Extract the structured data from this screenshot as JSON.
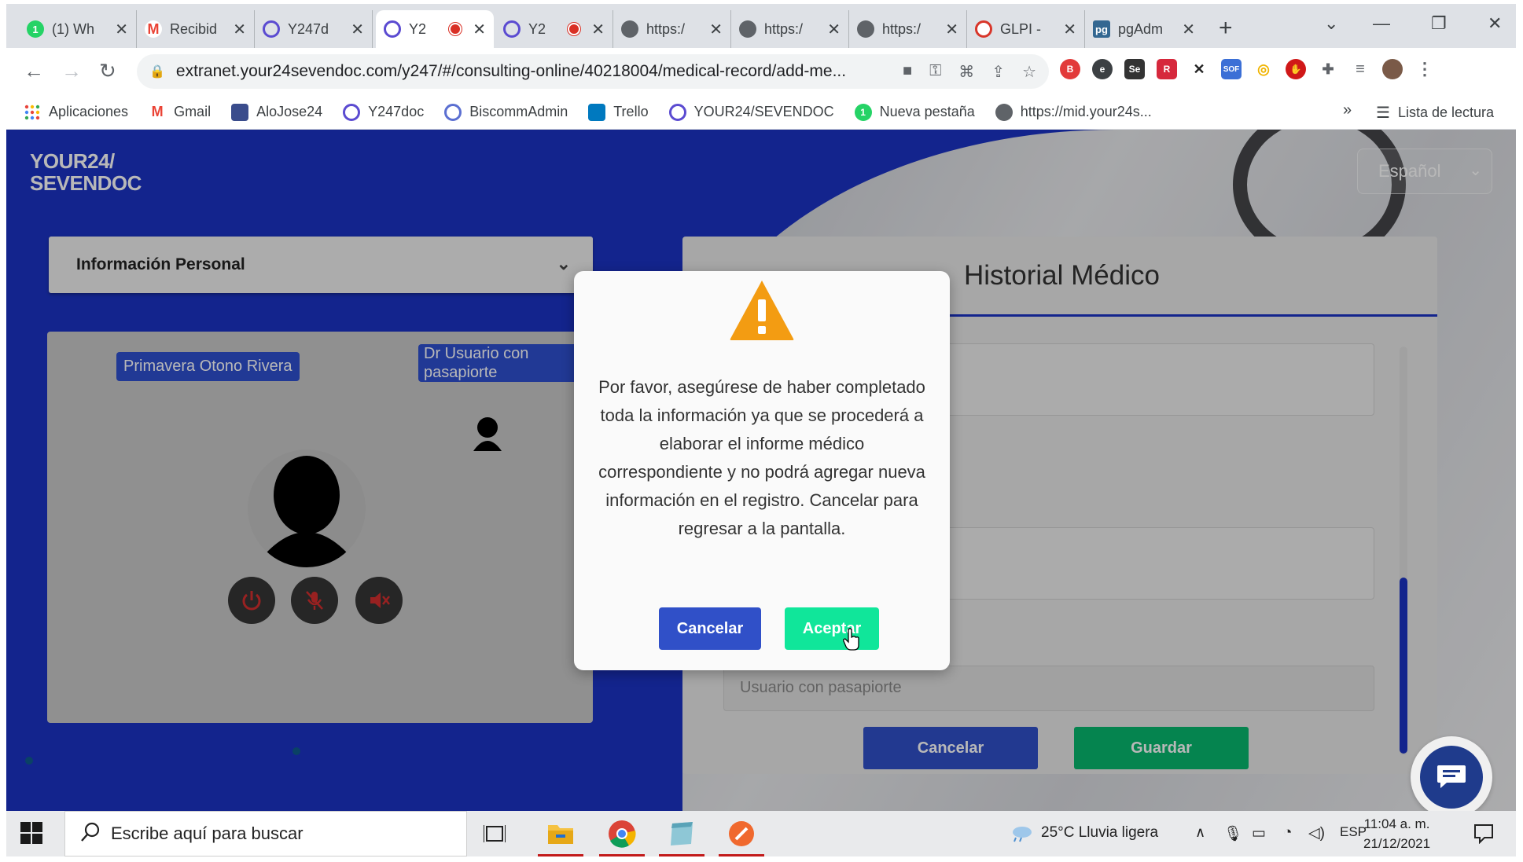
{
  "browser": {
    "tabs": [
      {
        "label": "(1) Wh",
        "icon": "whatsapp-icon",
        "color": "#25d366",
        "badge": "1"
      },
      {
        "label": "Recibid",
        "icon": "gmail-icon",
        "color": "#ea4335",
        "badge": "M"
      },
      {
        "label": "Y247d",
        "icon": "y247-icon",
        "color": "#5b4bd1",
        "badge": ""
      },
      {
        "label": "Y2",
        "icon": "y247-icon",
        "color": "#5b4bd1",
        "badge": "",
        "active": true,
        "recording": true
      },
      {
        "label": "Y2",
        "icon": "y247-icon",
        "color": "#5b4bd1",
        "badge": "",
        "recording": true
      },
      {
        "label": "https:/",
        "icon": "globe-icon",
        "color": "#5f6368",
        "badge": ""
      },
      {
        "label": "https:/",
        "icon": "globe-icon",
        "color": "#5f6368",
        "badge": ""
      },
      {
        "label": "https:/",
        "icon": "globe-icon",
        "color": "#5f6368",
        "badge": ""
      },
      {
        "label": "GLPI -",
        "icon": "glpi-icon",
        "color": "#d8362a",
        "badge": ""
      },
      {
        "label": "pgAdm",
        "icon": "pgadmin-icon",
        "color": "#336791",
        "badge": "pg"
      }
    ],
    "url": "extranet.your24sevendoc.com/y247/#/consulting-online/40218004/medical-record/add-me...",
    "bookmarks": [
      {
        "label": "Aplicaciones",
        "icon": "apps-grid-icon",
        "color": "#e8453c"
      },
      {
        "label": "Gmail",
        "icon": "gmail-icon",
        "color": "#ea4335"
      },
      {
        "label": "AloJose24",
        "icon": "alojose-icon",
        "color": "#3a4c8c"
      },
      {
        "label": "Y247doc",
        "icon": "y247-icon",
        "color": "#5b4bd1"
      },
      {
        "label": "BiscommAdmin",
        "icon": "biscomm-icon",
        "color": "#5b6fd1"
      },
      {
        "label": "Trello",
        "icon": "trello-icon",
        "color": "#0079bf"
      },
      {
        "label": "YOUR24/SEVENDOC",
        "icon": "y247-icon",
        "color": "#5b4bd1"
      },
      {
        "label": "Nueva pestaña",
        "icon": "whatsapp-icon",
        "color": "#25d366"
      },
      {
        "label": "https://mid.your24s...",
        "icon": "globe-icon",
        "color": "#5f6368"
      }
    ],
    "bookmarks_more": "»",
    "reading_list": "Lista de lectura",
    "extensions": [
      {
        "name": "ext-red-b-icon",
        "color": "#e23b3b",
        "text": "B"
      },
      {
        "name": "ext-e-icon",
        "color": "#3c4043",
        "text": "e"
      },
      {
        "name": "ext-se-icon",
        "color": "#333333",
        "text": "Se"
      },
      {
        "name": "ext-r-icon",
        "color": "#d6283c",
        "text": "R"
      },
      {
        "name": "ext-arrow-icon",
        "color": "#222222",
        "text": "✕"
      },
      {
        "name": "ext-sof-icon",
        "color": "#3b6fd6",
        "text": "SOF"
      },
      {
        "name": "ext-chrome-icon",
        "color": "#f0b400",
        "text": "◎"
      },
      {
        "name": "ext-stop-icon",
        "color": "#d01818",
        "text": "✋"
      },
      {
        "name": "ext-puzzle-icon",
        "color": "#5f6368",
        "text": "✚"
      },
      {
        "name": "ext-queue-icon",
        "color": "#5f6368",
        "text": "≡"
      }
    ]
  },
  "page": {
    "logo_line1": "YOUR24/",
    "logo_line2": "SEVENDOC",
    "language": "Español",
    "info_panel_title": "Información Personal",
    "video": {
      "patient_name": "Primavera Otono Rivera",
      "doctor_name": "Dr Usuario con pasapiorte"
    },
    "record": {
      "title": "Historial Médico",
      "input_value": "Usuario con pasapiorte",
      "cancel_label": "Cancelar",
      "save_label": "Guardar"
    }
  },
  "modal": {
    "message": "Por favor, asegúrese de haber completado toda la información ya que se procederá a elaborar el informe médico correspondiente y no podrá agregar nueva información en el registro. Cancelar para regresar a la pantalla.",
    "cancel_label": "Cancelar",
    "accept_label": "Aceptar"
  },
  "taskbar": {
    "search_placeholder": "Escribe aquí para buscar",
    "weather": "25°C  Lluvia ligera",
    "language": "ESP",
    "time": "11:04 a. m.",
    "date": "21/12/2021"
  },
  "colors": {
    "brand_blue": "#1b33c4",
    "accept_green": "#10e69a",
    "save_green": "#07b86e",
    "cancel_blue": "#3050c8"
  }
}
